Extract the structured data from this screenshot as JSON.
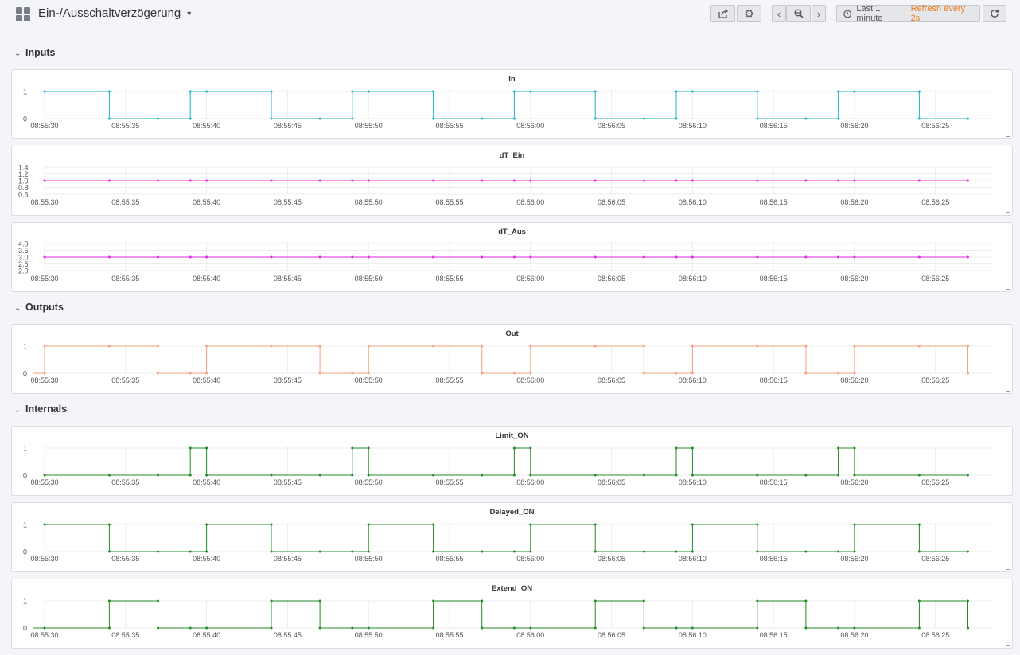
{
  "header": {
    "title": "Ein-/Ausschaltverzögerung",
    "time_range": "Last 1 minute",
    "refresh": "Refresh every 2s"
  },
  "icons": {
    "dashboard": "grid-icon",
    "share": "share-icon",
    "settings": "gear-icon",
    "back": "chevron-left-icon",
    "zoom_out": "zoom-out-icon",
    "forward": "chevron-right-icon",
    "clock": "clock-icon",
    "refresh": "refresh-icon"
  },
  "colors": {
    "In": "#1fb2cc",
    "dT": "#e02ae0",
    "Out": "#f5a282",
    "internal": "#238b23",
    "refresh_text": "#eb7b18"
  },
  "rows": [
    {
      "id": "inputs",
      "title": "Inputs"
    },
    {
      "id": "outputs",
      "title": "Outputs"
    },
    {
      "id": "internals",
      "title": "Internals"
    }
  ],
  "x_ticks": [
    "08:55:30",
    "08:55:35",
    "08:55:40",
    "08:55:45",
    "08:55:50",
    "08:55:55",
    "08:56:00",
    "08:56:05",
    "08:56:10",
    "08:56:15",
    "08:56:20",
    "08:56:25"
  ],
  "chart_data": [
    {
      "type": "line",
      "title": "In",
      "x_unit": "seconds after 08:55:30",
      "xlim": [
        0,
        58.5
      ],
      "y_ticks": [
        "1",
        "0"
      ],
      "ylim": [
        0,
        1
      ],
      "step": true,
      "color": "#1fb2cc",
      "series": [
        {
          "x": [
            0,
            4,
            4,
            7,
            9,
            9,
            10,
            14,
            14,
            17,
            19,
            19,
            20,
            24,
            24,
            27,
            29,
            29,
            30,
            34,
            34,
            37,
            39,
            39,
            40,
            44,
            44,
            47,
            49,
            49,
            50,
            54,
            54,
            57
          ],
          "y": [
            1,
            1,
            0,
            0,
            0,
            1,
            1,
            1,
            0,
            0,
            0,
            1,
            1,
            1,
            0,
            0,
            0,
            1,
            1,
            1,
            0,
            0,
            0,
            1,
            1,
            1,
            0,
            0,
            0,
            1,
            1,
            1,
            0,
            0
          ]
        }
      ]
    },
    {
      "type": "line",
      "title": "dT_Ein",
      "x_unit": "seconds after 08:55:30",
      "xlim": [
        0,
        58.5
      ],
      "y_ticks": [
        "1.4",
        "1.2",
        "1.0",
        "0.8",
        "0.6"
      ],
      "ylim": [
        0.6,
        1.4
      ],
      "step": false,
      "color": "#e02ae0",
      "series": [
        {
          "x": [
            0,
            4,
            7,
            9,
            10,
            14,
            17,
            19,
            20,
            24,
            27,
            29,
            30,
            34,
            37,
            39,
            40,
            44,
            47,
            49,
            50,
            54,
            57
          ],
          "y": [
            1,
            1,
            1,
            1,
            1,
            1,
            1,
            1,
            1,
            1,
            1,
            1,
            1,
            1,
            1,
            1,
            1,
            1,
            1,
            1,
            1,
            1,
            1
          ]
        }
      ]
    },
    {
      "type": "line",
      "title": "dT_Aus",
      "x_unit": "seconds after 08:55:30",
      "xlim": [
        0,
        58.5
      ],
      "y_ticks": [
        "4.0",
        "3.5",
        "3.0",
        "2.5",
        "2.0"
      ],
      "ylim": [
        2,
        4
      ],
      "step": false,
      "color": "#e02ae0",
      "series": [
        {
          "x": [
            0,
            4,
            7,
            9,
            10,
            14,
            17,
            19,
            20,
            24,
            27,
            29,
            30,
            34,
            37,
            39,
            40,
            44,
            47,
            49,
            50,
            54,
            57
          ],
          "y": [
            3,
            3,
            3,
            3,
            3,
            3,
            3,
            3,
            3,
            3,
            3,
            3,
            3,
            3,
            3,
            3,
            3,
            3,
            3,
            3,
            3,
            3,
            3
          ]
        }
      ]
    },
    {
      "type": "line",
      "title": "Out",
      "x_unit": "seconds after 08:55:30",
      "xlim": [
        0,
        58.5
      ],
      "y_ticks": [
        "1",
        "0"
      ],
      "ylim": [
        0,
        1
      ],
      "step": true,
      "color": "#f5a282",
      "series": [
        {
          "x": [
            -0.7,
            0,
            0,
            4,
            7,
            7,
            9,
            10,
            10,
            14,
            17,
            17,
            19,
            20,
            20,
            24,
            27,
            27,
            29,
            30,
            30,
            34,
            37,
            37,
            39,
            40,
            40,
            44,
            47,
            47,
            49,
            50,
            50,
            54,
            57,
            57
          ],
          "y": [
            0,
            0,
            1,
            1,
            1,
            0,
            0,
            0,
            1,
            1,
            1,
            0,
            0,
            0,
            1,
            1,
            1,
            0,
            0,
            0,
            1,
            1,
            1,
            0,
            0,
            0,
            1,
            1,
            1,
            0,
            0,
            0,
            1,
            1,
            1,
            0
          ]
        }
      ]
    },
    {
      "type": "line",
      "title": "Limit_ON",
      "x_unit": "seconds after 08:55:30",
      "xlim": [
        0,
        58.5
      ],
      "y_ticks": [
        "1",
        "0"
      ],
      "ylim": [
        0,
        1
      ],
      "step": true,
      "color": "#238b23",
      "series": [
        {
          "x": [
            0,
            4,
            7,
            9,
            9,
            10,
            10,
            14,
            17,
            19,
            19,
            20,
            20,
            24,
            27,
            29,
            29,
            30,
            30,
            34,
            37,
            39,
            39,
            40,
            40,
            44,
            47,
            49,
            49,
            50,
            50,
            54,
            57
          ],
          "y": [
            0,
            0,
            0,
            0,
            1,
            1,
            0,
            0,
            0,
            0,
            1,
            1,
            0,
            0,
            0,
            0,
            1,
            1,
            0,
            0,
            0,
            0,
            1,
            1,
            0,
            0,
            0,
            0,
            1,
            1,
            0,
            0,
            0
          ]
        }
      ]
    },
    {
      "type": "line",
      "title": "Delayed_ON",
      "x_unit": "seconds after 08:55:30",
      "xlim": [
        0,
        58.5
      ],
      "y_ticks": [
        "1",
        "0"
      ],
      "ylim": [
        0,
        1
      ],
      "step": true,
      "color": "#238b23",
      "series": [
        {
          "x": [
            0,
            4,
            4,
            7,
            9,
            10,
            10,
            14,
            14,
            17,
            19,
            20,
            20,
            24,
            24,
            27,
            29,
            30,
            30,
            34,
            34,
            37,
            39,
            40,
            40,
            44,
            44,
            47,
            49,
            50,
            50,
            54,
            54,
            57
          ],
          "y": [
            1,
            1,
            0,
            0,
            0,
            0,
            1,
            1,
            0,
            0,
            0,
            0,
            1,
            1,
            0,
            0,
            0,
            0,
            1,
            1,
            0,
            0,
            0,
            0,
            1,
            1,
            0,
            0,
            0,
            0,
            1,
            1,
            0,
            0
          ]
        }
      ]
    },
    {
      "type": "line",
      "title": "Extend_ON",
      "x_unit": "seconds after 08:55:30",
      "xlim": [
        0,
        58.5
      ],
      "y_ticks": [
        "1",
        "0"
      ],
      "ylim": [
        0,
        1
      ],
      "step": true,
      "color": "#238b23",
      "series": [
        {
          "x": [
            -0.7,
            0,
            4,
            4,
            7,
            7,
            9,
            10,
            14,
            14,
            17,
            17,
            19,
            20,
            24,
            24,
            27,
            27,
            29,
            30,
            34,
            34,
            37,
            37,
            39,
            40,
            44,
            44,
            47,
            47,
            49,
            50,
            54,
            54,
            57,
            57
          ],
          "y": [
            0,
            0,
            0,
            1,
            1,
            0,
            0,
            0,
            0,
            1,
            1,
            0,
            0,
            0,
            0,
            1,
            1,
            0,
            0,
            0,
            0,
            1,
            1,
            0,
            0,
            0,
            0,
            1,
            1,
            0,
            0,
            0,
            0,
            1,
            1,
            0
          ]
        }
      ]
    }
  ]
}
